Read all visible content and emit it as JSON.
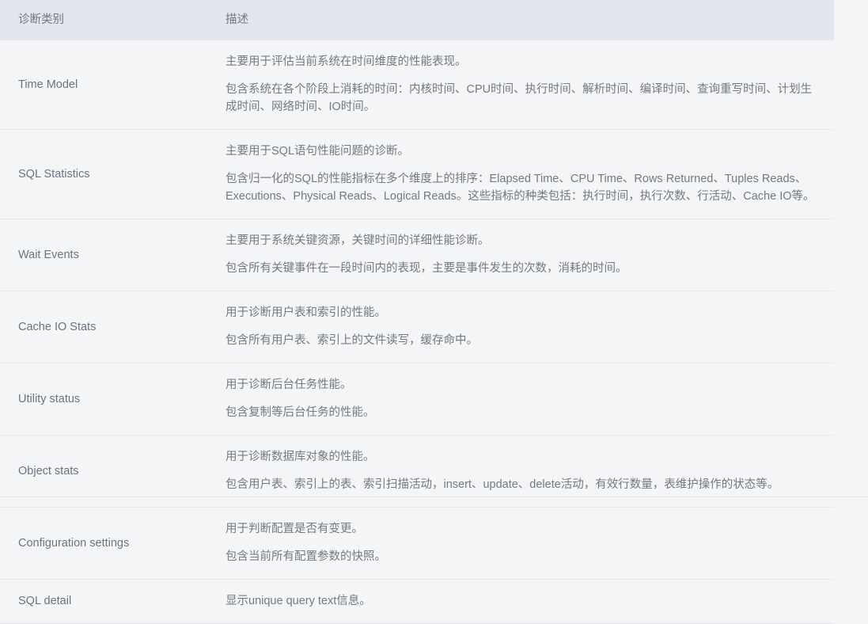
{
  "table": {
    "columns": [
      {
        "key": "category",
        "label": "诊断类别"
      },
      {
        "key": "description",
        "label": "描述"
      }
    ],
    "rows": [
      {
        "category": "Time Model",
        "paragraphs": [
          "主要用于评估当前系统在时间维度的性能表现。",
          "包含系统在各个阶段上消耗的时间：内核时间、CPU时间、执行时间、解析时间、编译时间、查询重写时间、计划生成时间、网络时间、IO时间。"
        ]
      },
      {
        "category": "SQL Statistics",
        "paragraphs": [
          "主要用于SQL语句性能问题的诊断。",
          "包含归一化的SQL的性能指标在多个维度上的排序：Elapsed Time、CPU Time、Rows Returned、Tuples Reads、Executions、Physical Reads、Logical Reads。这些指标的种类包括：执行时间，执行次数、行活动、Cache IO等。"
        ]
      },
      {
        "category": "Wait Events",
        "paragraphs": [
          "主要用于系统关键资源，关键时间的详细性能诊断。",
          "包含所有关键事件在一段时间内的表现，主要是事件发生的次数，消耗的时间。"
        ]
      },
      {
        "category": "Cache IO Stats",
        "paragraphs": [
          "用于诊断用户表和索引的性能。",
          "包含所有用户表、索引上的文件读写，缓存命中。"
        ]
      },
      {
        "category": "Utility status",
        "paragraphs": [
          "用于诊断后台任务性能。",
          "包含复制等后台任务的性能。"
        ]
      },
      {
        "category": "Object stats",
        "paragraphs": [
          "用于诊断数据库对象的性能。",
          "包含用户表、索引上的表、索引扫描活动，insert、update、delete活动，有效行数量，表维护操作的状态等。"
        ]
      },
      {
        "category": "Configuration settings",
        "paragraphs": [
          "用于判断配置是否有变更。",
          "包含当前所有配置参数的快照。"
        ]
      },
      {
        "category": "SQL detail",
        "paragraphs": [
          "显示unique query text信息。"
        ]
      }
    ]
  },
  "colors": {
    "header_bg": "#e3e6ee",
    "page_bg": "#f4f5f7",
    "row_border": "#e6e8ec",
    "text": "#72797f"
  }
}
